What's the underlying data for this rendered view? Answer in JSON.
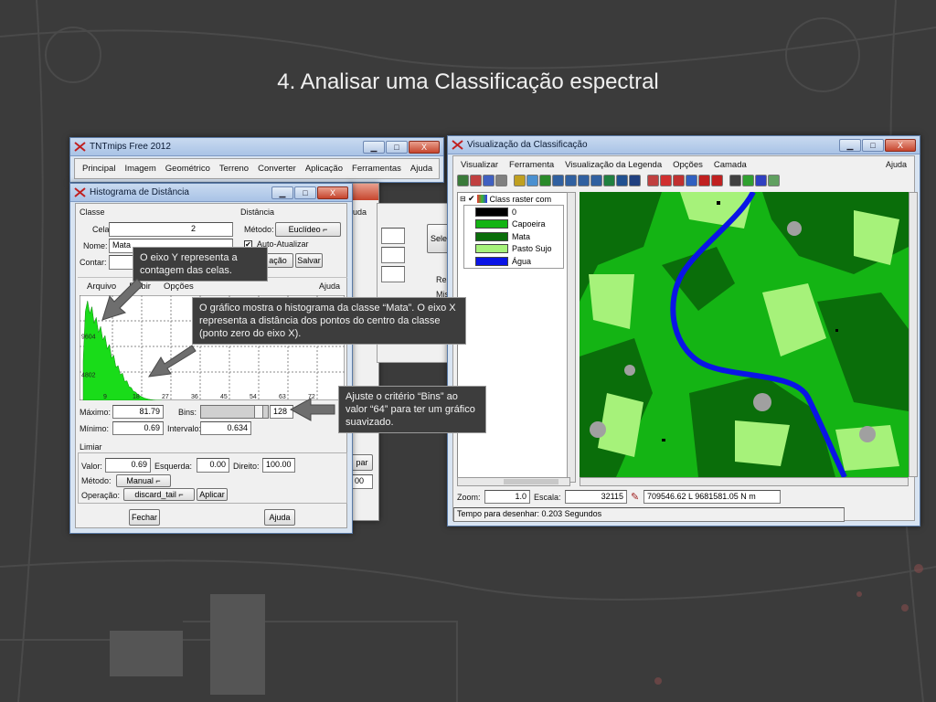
{
  "slide": {
    "title": "4. Analisar uma Classificação espectral"
  },
  "tntmips": {
    "title": "TNTmips Free 2012",
    "menu": [
      "Principal",
      "Imagem",
      "Geométrico",
      "Terreno",
      "Converter",
      "Aplicação",
      "Ferramentas",
      "Ajuda"
    ]
  },
  "histogram": {
    "title": "Histograma de Distância",
    "classe_label": "Classe",
    "distancia_label": "Distância",
    "cela_label": "Cela:",
    "cela_value": "2",
    "nome_label": "Nome:",
    "nome_value": "Mata",
    "contar_label": "Contar:",
    "metodo_label": "Método:",
    "metodo_value": "Euclídeo",
    "auto_label": "Auto-Atualizar",
    "partial_left_button": "ação",
    "salvar_button": "Salvar",
    "menu": [
      "Arquivo",
      "Exibir",
      "Opções"
    ],
    "menu_help": "Ajuda",
    "maximo_label": "Máximo:",
    "maximo_value": "81.79",
    "minimo_label": "Mínimo:",
    "minimo_value": "0.69",
    "bins_label": "Bins:",
    "bins_value": "128",
    "intervalo_label": "Intervalo:",
    "intervalo_value": "0.634",
    "limiar_label": "Limiar",
    "valor_label": "Valor:",
    "valor_value": "0.69",
    "esquerda_label": "Esquerda:",
    "esquerda_value": "0.00",
    "direito_label": "Direito:",
    "direito_value": "100.00",
    "metodo2_label": "Método:",
    "metodo2_value": "Manual",
    "operacao_label": "Operação:",
    "operacao_value": "discard_tail",
    "aplicar_button": "Aplicar",
    "fechar_button": "Fechar",
    "ajuda_button": "Ajuda"
  },
  "behind_window": {
    "partial_help": "uda",
    "partial_sel": "Sele",
    "partial_re": "Re",
    "partial_mis": "Mis",
    "partial_par": "par",
    "partial_00": "00"
  },
  "chart_data": {
    "type": "area",
    "x_ticks": [
      "9",
      "18",
      "27",
      "36",
      "45",
      "54",
      "63",
      "72"
    ],
    "y_ticks": [
      "9604",
      "4802"
    ],
    "series": [
      {
        "values": [
          5200,
          11800,
          13200,
          11500,
          12400,
          10200,
          11000,
          9000,
          9800,
          8000,
          8600,
          6800,
          7400,
          5600,
          6000,
          4400,
          4600,
          3400,
          3600,
          2500,
          2600,
          1800,
          1700,
          1200,
          1100,
          800,
          600,
          450,
          300,
          220,
          150,
          100,
          60,
          40,
          20,
          10,
          0
        ]
      }
    ],
    "colors": {
      "fill": "#19dc19",
      "background": "#ffffff"
    }
  },
  "classification": {
    "title": "Visualização da Classificação",
    "menu": [
      "Visualizar",
      "Ferramenta",
      "Visualização da Legenda",
      "Opções",
      "Camada"
    ],
    "menu_help": "Ajuda",
    "layer_title": "Class raster com",
    "legend": [
      {
        "label": "0",
        "color": "#000000"
      },
      {
        "label": "Capoeira",
        "color": "#14b414"
      },
      {
        "label": "Mata",
        "color": "#0a6e0a"
      },
      {
        "label": "Pasto Sujo",
        "color": "#a6f27a"
      },
      {
        "label": "Água",
        "color": "#0a14e6"
      }
    ],
    "zoom_label": "Zoom:",
    "zoom_value": "1.0",
    "escala_label": "Escala:",
    "escala_value": "32115",
    "coords": "709546.62 L  9681581.05 N m",
    "status": "Tempo para desenhar: 0.203 Segundos"
  },
  "callouts": {
    "y_axis": "O eixo Y representa a contagem das celas.",
    "graph": "O gráfico mostra o histograma da classe “Mata”. O eixo X representa a distância dos pontos do centro da classe (ponto zero do eixo X).",
    "bins": "Ajuste o critério “Bins” ao valor “64” para ter um gráfico suavizado."
  },
  "icons": [
    "tntmips-logo-icon",
    "histogram-logo-icon",
    "classification-logo-icon",
    "checkbox-icon",
    "arrow-icon"
  ]
}
